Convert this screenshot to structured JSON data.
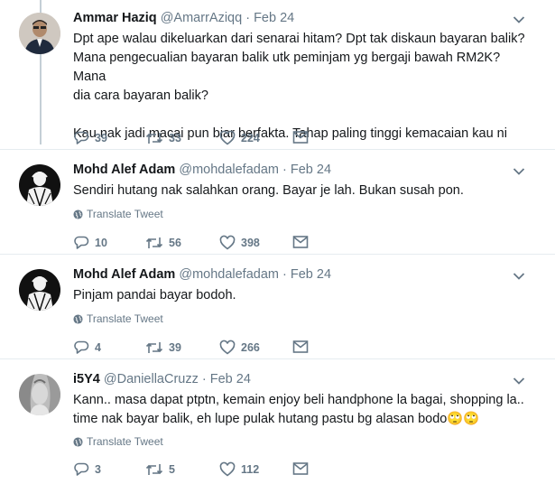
{
  "tweets": [
    {
      "name": "Ammar Haziq",
      "handle": "@AmarrAziqq",
      "date": "Feb 24",
      "lines": [
        "Dpt ape walau dikeluarkan dari senarai hitam? Dpt tak diskaun bayaran balik?",
        "Mana pengecualian bayaran balik utk peminjam yg bergaji bawah RM2K? Mana",
        "dia cara bayaran balik?",
        "",
        "Kau nak jadi macai pun biar berfakta. Tahap paling tinggi kemacaian kau ni"
      ],
      "replies": "39",
      "retweets": "33",
      "likes": "224"
    },
    {
      "name": "Mohd Alef Adam",
      "handle": "@mohdalefadam",
      "date": "Feb 24",
      "lines": [
        "Sendiri hutang nak salahkan orang. Bayar je lah. Bukan susah pon."
      ],
      "translate": "Translate Tweet",
      "replies": "10",
      "retweets": "56",
      "likes": "398"
    },
    {
      "name": "Mohd Alef Adam",
      "handle": "@mohdalefadam",
      "date": "Feb 24",
      "lines": [
        "Pinjam pandai bayar bodoh."
      ],
      "translate": "Translate Tweet",
      "replies": "4",
      "retweets": "39",
      "likes": "266"
    },
    {
      "name": "i5Y4",
      "handle": "@DaniellaCruzz",
      "date": "Feb 24",
      "lines": [
        "Kann.. masa dapat ptptn, kemain enjoy beli handphone la bagai, shopping la..",
        "time nak bayar balik, eh lupe pulak hutang pastu bg alasan bodo🙄🙄"
      ],
      "translate": "Translate Tweet",
      "replies": "3",
      "retweets": "5",
      "likes": "112"
    }
  ],
  "separator": "·",
  "icons": [
    "reply-icon",
    "retweet-icon",
    "like-icon",
    "dm-icon",
    "globe-icon",
    "chevron-down-icon"
  ],
  "colors": {
    "text": "#14171a",
    "muted": "#657786",
    "border": "#e6ecf0"
  }
}
